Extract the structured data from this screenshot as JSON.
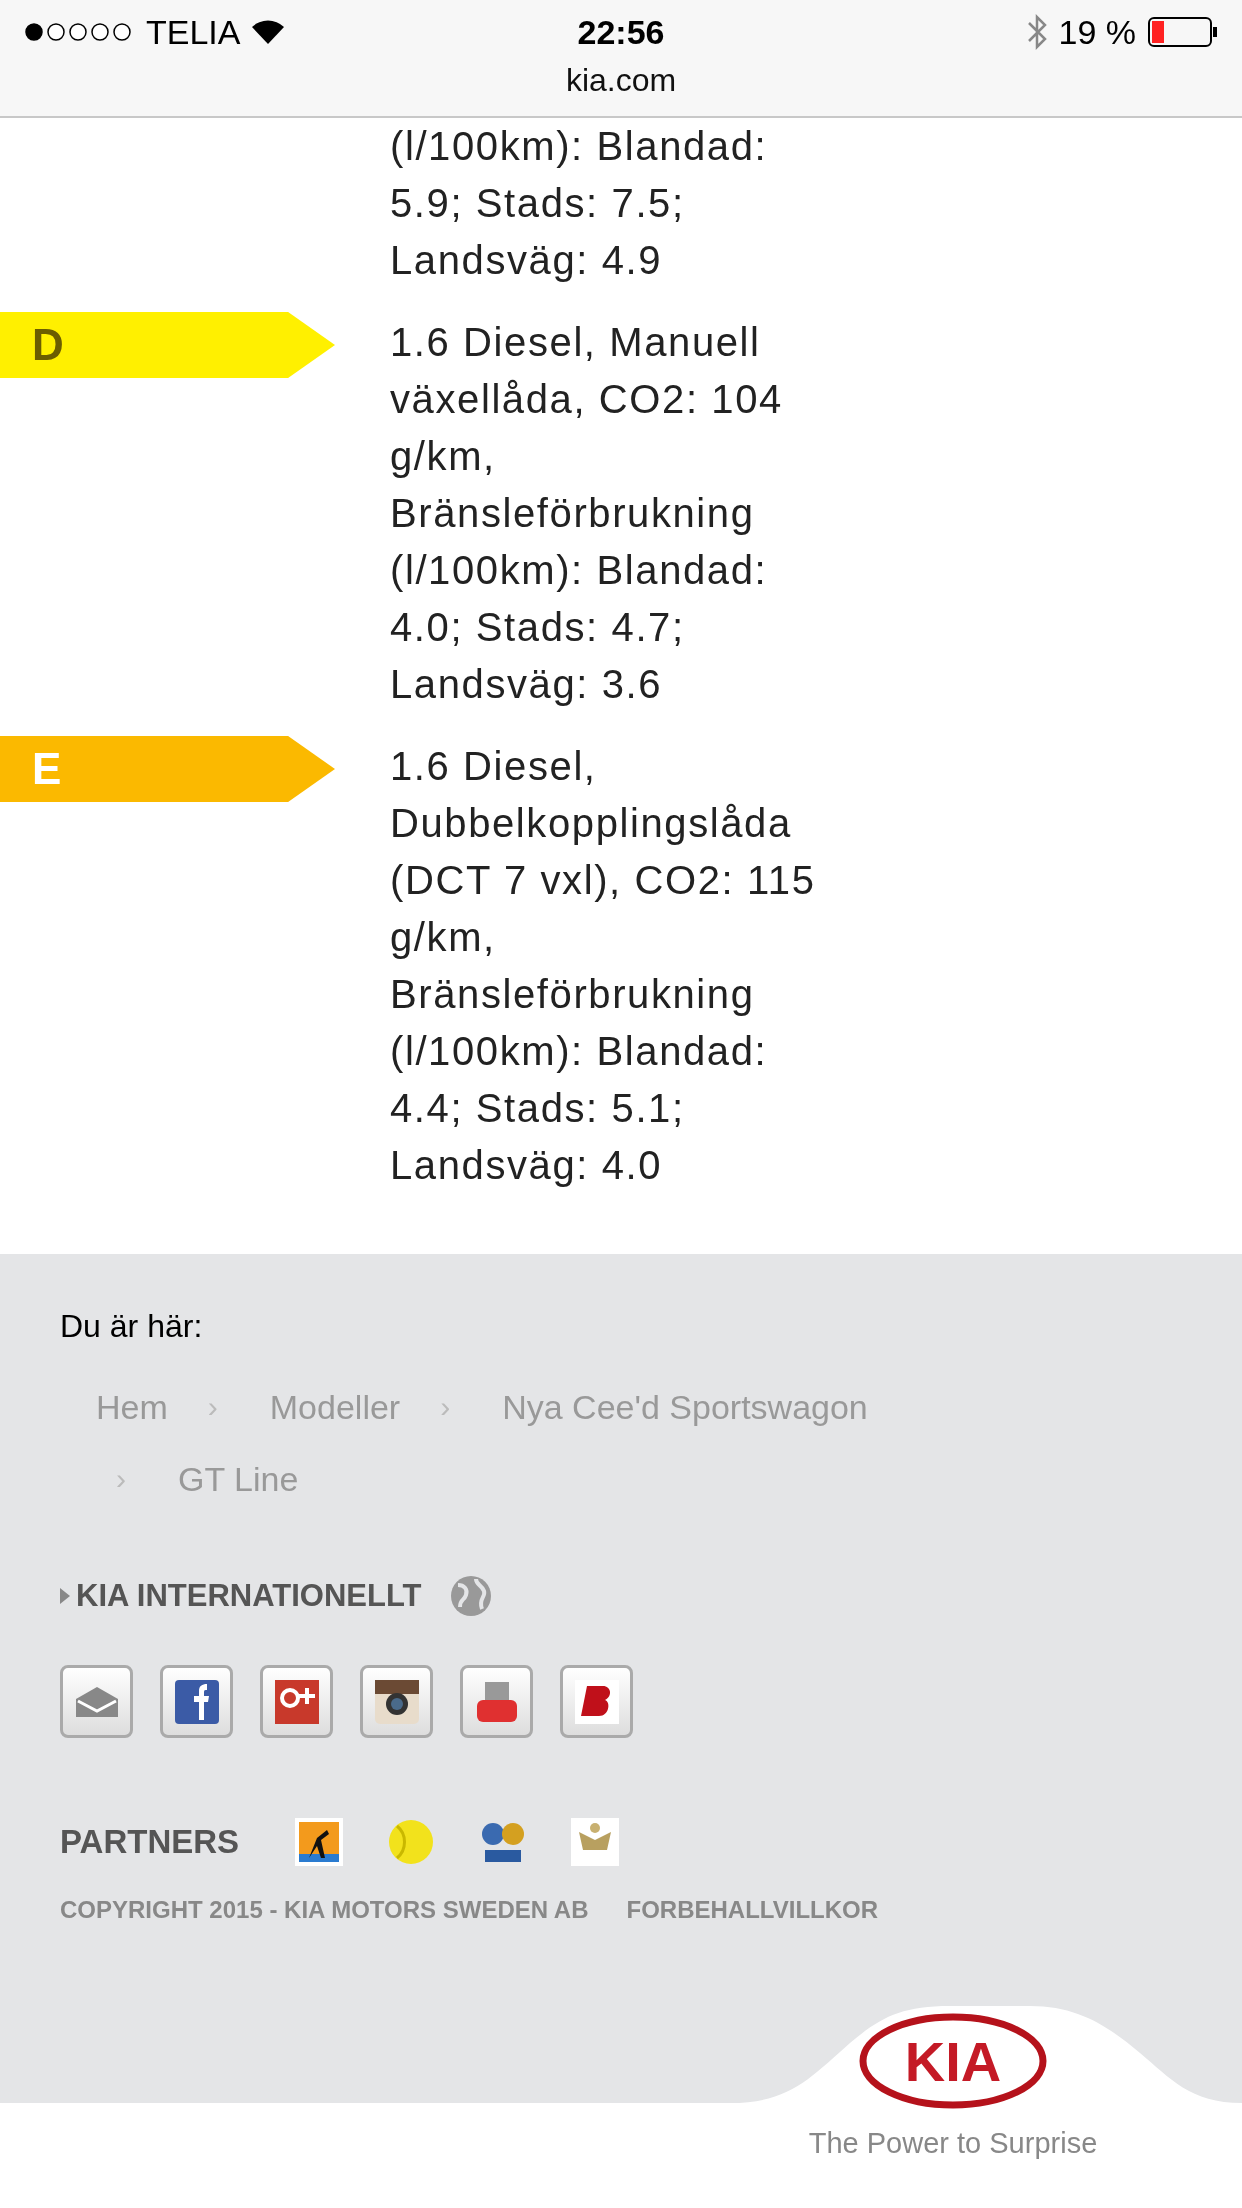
{
  "status_bar": {
    "carrier": "TELIA",
    "time": "22:56",
    "battery": "19 %",
    "url": "kia.com"
  },
  "entries": [
    {
      "lines": [
        "(l/100km): Blandad:",
        "5.9; Stads: 7.5;",
        "Landsväg: 4.9"
      ]
    },
    {
      "label": "D",
      "color": "#fff000",
      "lines": [
        "1.6 Diesel, Manuell",
        "växellåda, CO2: 104",
        "g/km,",
        "Bränsleförbrukning",
        "(l/100km): Blandad:",
        "4.0; Stads: 4.7;",
        "Landsväg: 3.6"
      ]
    },
    {
      "label": "E",
      "color": "#fbb900",
      "lines": [
        "1.6 Diesel,",
        "Dubbelkopplingslåda",
        "(DCT 7 vxl), CO2: 115",
        "g/km,",
        "Bränsleförbrukning",
        "(l/100km): Blandad:",
        "4.4; Stads: 5.1;",
        "Landsväg: 4.0"
      ]
    }
  ],
  "breadcrumb": {
    "title": "Du är här:",
    "separator": "›",
    "items": [
      "Hem",
      "Modeller",
      "Nya Cee'd Sportswagon",
      "GT Line"
    ]
  },
  "international": "KIA INTERNATIONELLT",
  "social": [
    {
      "kind": "mail"
    },
    {
      "kind": "facebook"
    },
    {
      "kind": "google"
    },
    {
      "kind": "instagram"
    },
    {
      "kind": "youtube"
    },
    {
      "kind": "blog"
    }
  ],
  "partners": {
    "title": "PARTNERS",
    "logos": [
      {
        "kind": "tennis-player"
      },
      {
        "kind": "tennis-ball"
      },
      {
        "kind": "football"
      },
      {
        "kind": "crest"
      }
    ]
  },
  "copyright": "COPYRIGHT 2015 - KIA MOTORS SWEDEN AB",
  "terms": "FORBEHALLVILLKOR",
  "logo": {
    "text": "KIA",
    "tagline": "The Power to Surprise"
  }
}
